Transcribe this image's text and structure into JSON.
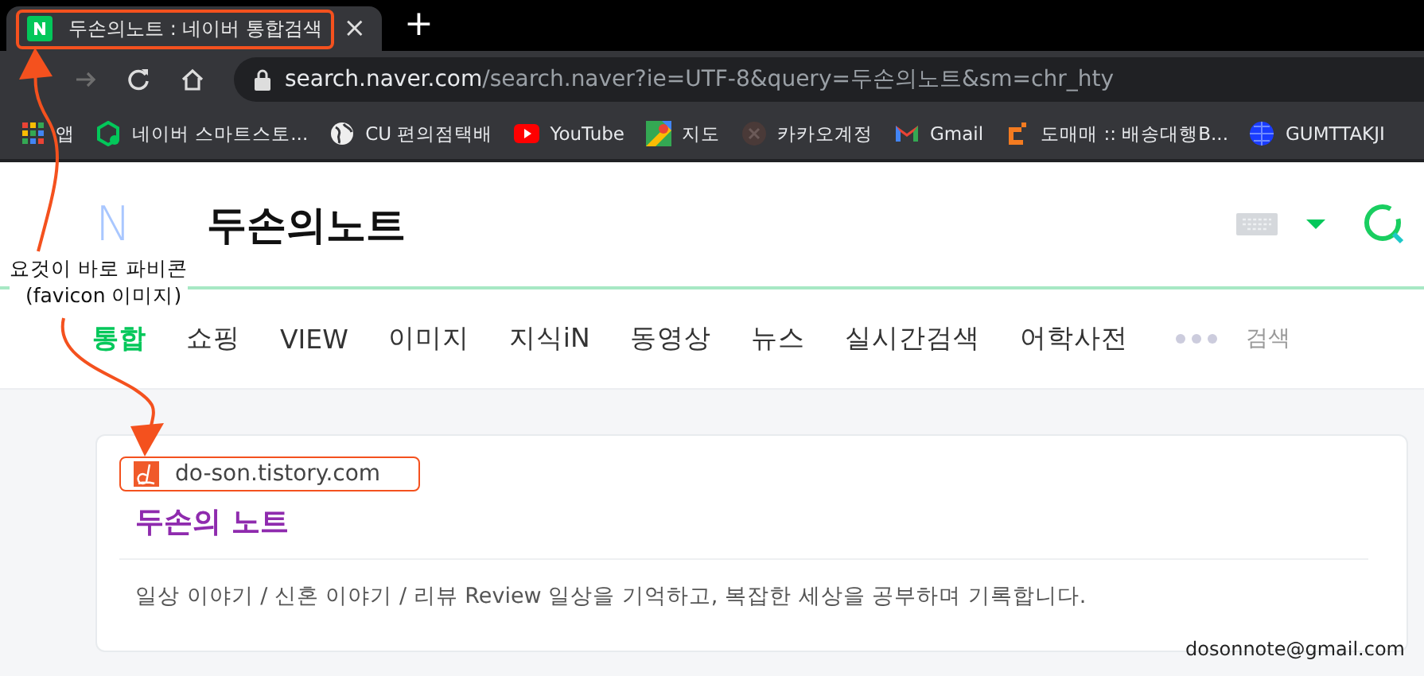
{
  "browser": {
    "tabs": [
      {
        "title": "두손의노트 : 네이버 통합검색",
        "close": "×",
        "selected": true,
        "annotated": true
      }
    ],
    "new_tab": "+",
    "address": {
      "host": "search.naver.com",
      "path": "/search.naver?ie=UTF-8&query=두손의노트&sm=chr_hty"
    },
    "bookmarks": [
      {
        "kind": "apps",
        "label": "앱"
      },
      {
        "kind": "store",
        "label": "네이버 스마트스토..."
      },
      {
        "kind": "globe",
        "label": "CU 편의점택배"
      },
      {
        "kind": "youtube",
        "label": "YouTube"
      },
      {
        "kind": "maps",
        "label": "지도"
      },
      {
        "kind": "kakao",
        "label": "카카오계정"
      },
      {
        "kind": "gmail",
        "label": "Gmail"
      },
      {
        "kind": "domeme",
        "label": "도매매 :: 배송대행B..."
      },
      {
        "kind": "bluenet",
        "label": "GUMTTAKJI"
      }
    ]
  },
  "search": {
    "logo": "N",
    "query": "두손의노트"
  },
  "nav": [
    {
      "label": "통합",
      "selected": true
    },
    {
      "label": "쇼핑",
      "selected": false
    },
    {
      "label": "VIEW",
      "selected": false
    },
    {
      "label": "이미지",
      "selected": false
    },
    {
      "label": "지식iN",
      "selected": false
    },
    {
      "label": "동영상",
      "selected": false
    },
    {
      "label": "뉴스",
      "selected": false
    },
    {
      "label": "실시간검색",
      "selected": false
    },
    {
      "label": "어학사전",
      "selected": false
    }
  ],
  "search_options": "검색",
  "result": {
    "site": "do-son.tistory.com",
    "site_annotated": true,
    "title": "두손의 노트",
    "description": "일상 이야기 / 신혼 이야기 / 리뷰 Review 일상을 기억하고, 복잡한 세상을 공부하며 기록합니다."
  },
  "annotation": {
    "lines": [
      "요것이 바로 파비콘",
      "(favicon 이미지)"
    ]
  },
  "signature": "dosonnote@gmail.com"
}
